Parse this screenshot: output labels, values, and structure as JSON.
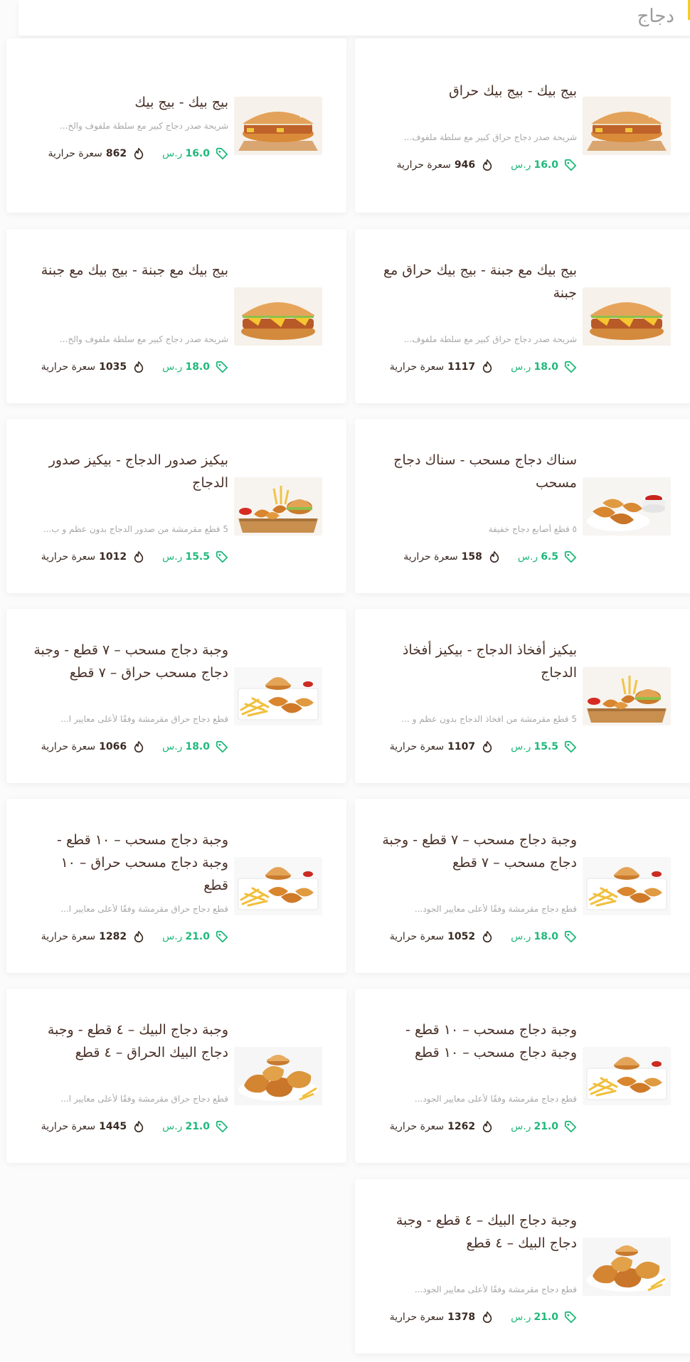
{
  "header": {
    "title": "دجاج"
  },
  "currency": "ر.س",
  "calories_unit": "سعرة حرارية",
  "colors": {
    "price": "#1fb97a",
    "accent": "#f3cf19"
  },
  "items": [
    {
      "name": "بيج بيك - بيج بيك حراق",
      "desc": "شريحة صدر دجاج حراق كبير مع سلطة ملفوف...",
      "price": "16.0",
      "calories": "946",
      "image": "sandwich"
    },
    {
      "name": "بيج بيك - بيج بيك",
      "desc": "شريحة صدر دجاج كبير مع سلطة ملفوف والخ...",
      "price": "16.0",
      "calories": "862",
      "image": "sandwich"
    },
    {
      "name": "بيج بيك مع جبنة - بيج بيك حراق مع جبنة",
      "desc": "شريحة صدر دجاج حراق كبير مع سلطة ملفوف...",
      "price": "18.0",
      "calories": "1117",
      "image": "cheese-sandwich"
    },
    {
      "name": "بيج بيك مع جبنة - بيج بيك مع جبنة",
      "desc": "شريحة صدر دجاج كبير مع سلطة ملفوف والخ...",
      "price": "18.0",
      "calories": "1035",
      "image": "cheese-sandwich"
    },
    {
      "name": "سناك دجاج مسحب - سناك دجاج مسحب",
      "desc": "٥ قطع أصابع دجاج خفيفة",
      "price": "6.5",
      "calories": "158",
      "image": "tenders-sauce"
    },
    {
      "name": "بيكيز صدور الدجاج - بيكيز صدور الدجاج",
      "desc": "5 قطع مقرمشة من صدور الدجاج بدون عظم و ب...",
      "price": "15.5",
      "calories": "1012",
      "image": "nuggets-board"
    },
    {
      "name": "بيكيز أفخاذ الدجاج - بيكيز أفخاذ الدجاج",
      "desc": "5 قطع مقرمشة من افخاذ الدجاج بدون عظم و ...",
      "price": "15.5",
      "calories": "1107",
      "image": "nuggets-board"
    },
    {
      "name": "وجبة دجاج مسحب – ٧ قطع - وجبة دجاج مسحب حراق – ٧ قطع",
      "desc": "قطع دجاج حراق مقرمشة وفقًا لأعلى معايير ا...",
      "price": "18.0",
      "calories": "1066",
      "image": "meal-tenders"
    },
    {
      "name": "وجبة دجاج مسحب – ٧ قطع - وجبة دجاج مسحب – ٧ قطع",
      "desc": "قطع دجاج مقرمشة وفقًا لأعلى معايير الجود...",
      "price": "18.0",
      "calories": "1052",
      "image": "meal-tenders"
    },
    {
      "name": "وجبة دجاج مسحب – ١٠ قطع - وجبة دجاج مسحب حراق – ١٠ قطع",
      "desc": "قطع دجاج حراق مقرمشة وفقًا لأعلى معايير ا...",
      "price": "21.0",
      "calories": "1282",
      "image": "meal-tenders"
    },
    {
      "name": "وجبة دجاج مسحب – ١٠ قطع - وجبة دجاج مسحب – ١٠ قطع",
      "desc": "قطع دجاج مقرمشة وفقًا لأعلى معايير الجود...",
      "price": "21.0",
      "calories": "1262",
      "image": "meal-tenders"
    },
    {
      "name": "وجبة دجاج البيك – ٤ قطع - وجبة دجاج البيك الحراق – ٤ قطع",
      "desc": "قطع دجاج حراق مقرمشة وفقًا لأعلى معايير ا...",
      "price": "21.0",
      "calories": "1445",
      "image": "fried-chicken"
    },
    {
      "name": "وجبة دجاج البيك – ٤ قطع - وجبة دجاج البيك – ٤ قطع",
      "desc": "قطع دجاج مقرمشة وفقًا لأعلى معايير الجود...",
      "price": "21.0",
      "calories": "1378",
      "image": "fried-chicken"
    }
  ]
}
